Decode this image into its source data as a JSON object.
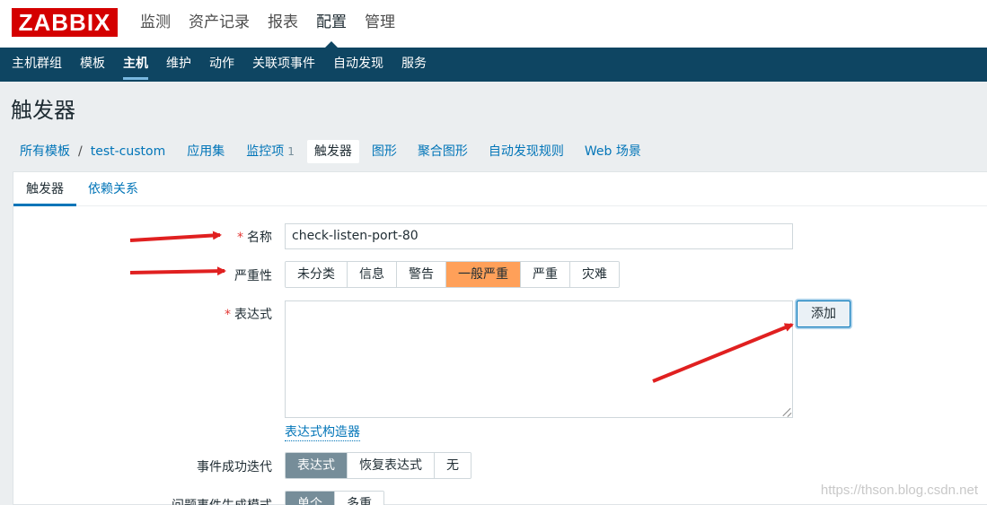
{
  "logo": "ZABBIX",
  "top_menu": [
    {
      "label": "监测",
      "active": false
    },
    {
      "label": "资产记录",
      "active": false
    },
    {
      "label": "报表",
      "active": false
    },
    {
      "label": "配置",
      "active": true
    },
    {
      "label": "管理",
      "active": false
    }
  ],
  "sub_menu": [
    {
      "label": "主机群组",
      "active": false
    },
    {
      "label": "模板",
      "active": false
    },
    {
      "label": "主机",
      "active": true
    },
    {
      "label": "维护",
      "active": false
    },
    {
      "label": "动作",
      "active": false
    },
    {
      "label": "关联项事件",
      "active": false
    },
    {
      "label": "自动发现",
      "active": false
    },
    {
      "label": "服务",
      "active": false
    }
  ],
  "page_title": "触发器",
  "host_nav": {
    "all_templates": "所有模板",
    "separator": "/",
    "host": "test-custom",
    "applications": "应用集",
    "items": "监控项",
    "items_count": "1",
    "triggers": "触发器",
    "graphs": "图形",
    "screens": "聚合图形",
    "discovery": "自动发现规则",
    "web": "Web 场景"
  },
  "tabs": {
    "trigger": "触发器",
    "dependencies": "依赖关系"
  },
  "form": {
    "required_mark": "*",
    "name_label": "名称",
    "name_value": "check-listen-port-80",
    "severity_label": "严重性",
    "severity_options": [
      "未分类",
      "信息",
      "警告",
      "一般严重",
      "严重",
      "灾难"
    ],
    "severity_selected": "一般严重",
    "expression_label": "表达式",
    "expression_value": "",
    "add_button": "添加",
    "expression_builder": "表达式构造器",
    "ok_event_label": "事件成功迭代",
    "ok_event_options": [
      "表达式",
      "恢复表达式",
      "无"
    ],
    "ok_event_selected": "表达式",
    "problem_mode_label": "问题事件生成模式",
    "problem_mode_options": [
      "单个",
      "多重"
    ],
    "problem_mode_selected": "单个"
  },
  "watermark": "https://thson.blog.csdn.net",
  "colors": {
    "logo_red": "#d40000",
    "nav_blue": "#0e4562",
    "link_blue": "#0275b8",
    "selected_orange": "#ffa059",
    "selected_gray": "#768d99",
    "annotation_red": "#e02020"
  }
}
